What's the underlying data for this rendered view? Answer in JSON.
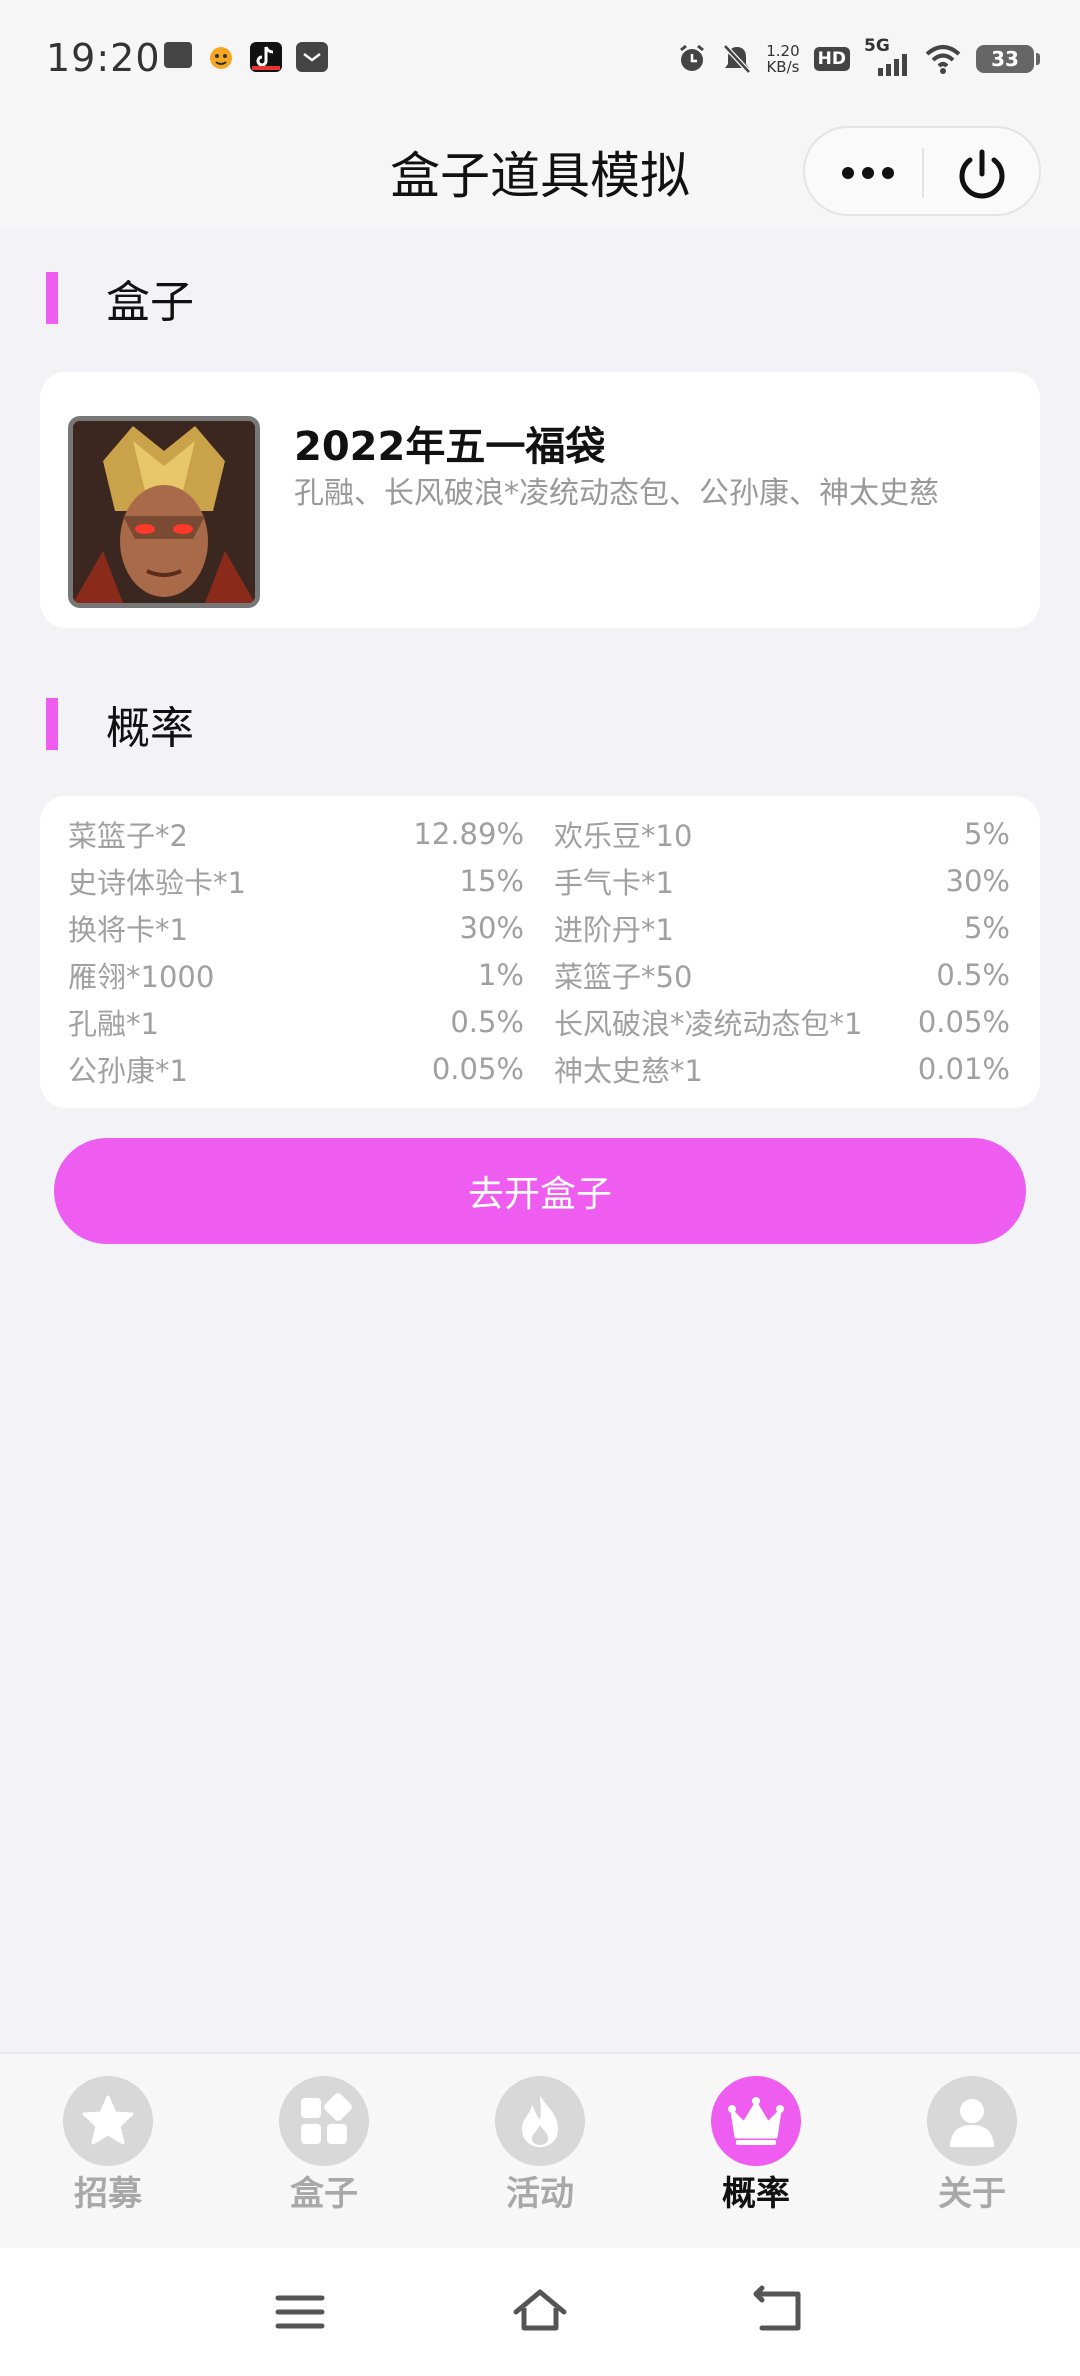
{
  "status_bar": {
    "time": "19:20",
    "network_speed_value": "1.20",
    "network_speed_unit": "KB/s",
    "hd_label": "HD",
    "network_type": "5G",
    "battery": "33",
    "icons": [
      "notes-app-icon",
      "animal-app-icon",
      "tiktok-app-icon",
      "mail-app-icon",
      "alarm-icon",
      "mute-icon",
      "signal-icon",
      "wifi-icon"
    ]
  },
  "nav": {
    "title": "盒子道具模拟"
  },
  "box_section": {
    "title": "盒子",
    "box": {
      "name": "2022年五一福袋",
      "description": "孔融、长风破浪*凌统动态包、公孙康、神太史慈"
    }
  },
  "prob_section": {
    "title": "概率",
    "rows": [
      [
        {
          "item": "菜篮子*2",
          "rate": "12.89%"
        },
        {
          "item": "欢乐豆*10",
          "rate": "5%"
        }
      ],
      [
        {
          "item": "史诗体验卡*1",
          "rate": "15%"
        },
        {
          "item": "手气卡*1",
          "rate": "30%"
        }
      ],
      [
        {
          "item": "换将卡*1",
          "rate": "30%"
        },
        {
          "item": "进阶丹*1",
          "rate": "5%"
        }
      ],
      [
        {
          "item": "雁翎*1000",
          "rate": "1%"
        },
        {
          "item": "菜篮子*50",
          "rate": "0.5%"
        }
      ],
      [
        {
          "item": "孔融*1",
          "rate": "0.5%"
        },
        {
          "item": "长风破浪*凌统动态包*1",
          "rate": "0.05%"
        }
      ],
      [
        {
          "item": "公孙康*1",
          "rate": "0.05%"
        },
        {
          "item": "神太史慈*1",
          "rate": "0.01%"
        }
      ]
    ]
  },
  "action": {
    "open_box_label": "去开盒子"
  },
  "tabs": [
    {
      "label": "招募",
      "icon": "star-icon",
      "active": false
    },
    {
      "label": "盒子",
      "icon": "grid-icon",
      "active": false
    },
    {
      "label": "活动",
      "icon": "flame-icon",
      "active": false
    },
    {
      "label": "概率",
      "icon": "crown-icon",
      "active": true
    },
    {
      "label": "关于",
      "icon": "person-icon",
      "active": false
    }
  ],
  "colors": {
    "accent": "#ee5cf0",
    "background": "#f2f2f7",
    "muted_text": "#a0a0a0"
  }
}
